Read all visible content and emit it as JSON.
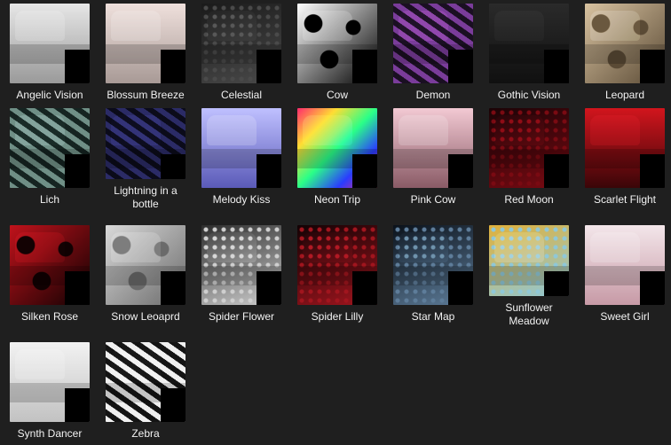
{
  "items": [
    {
      "label": "Angelic Vision",
      "c1": "#e6e6e6",
      "c2": "#9a9a9a",
      "pattern": "soft"
    },
    {
      "label": "Blossum Breeze",
      "c1": "#efe0dc",
      "c2": "#a89a96",
      "pattern": "soft"
    },
    {
      "label": "Celestial",
      "c1": "#4a4a4a",
      "c2": "#1a1a1a",
      "pattern": "dots"
    },
    {
      "label": "Cow",
      "c1": "#ffffff",
      "c2": "#000000",
      "pattern": "spots"
    },
    {
      "label": "Demon",
      "c1": "#7a3c9a",
      "c2": "#1a0f22",
      "pattern": "stripe"
    },
    {
      "label": "Gothic Vision",
      "c1": "#2a2a2a",
      "c2": "#101010",
      "pattern": "soft"
    },
    {
      "label": "Leopard",
      "c1": "#d8c2a0",
      "c2": "#5a4a35",
      "pattern": "spots"
    },
    {
      "label": "Lich",
      "c1": "#6f8f86",
      "c2": "#152421",
      "pattern": "stripe"
    },
    {
      "label": "Lightning in a bottle",
      "c1": "#2b2b66",
      "c2": "#0b0b1a",
      "pattern": "stripe"
    },
    {
      "label": "Melody Kiss",
      "c1": "#bfc0ff",
      "c2": "#5a5ab8",
      "pattern": "soft"
    },
    {
      "label": "Neon Trip",
      "c1": "#ffdd33",
      "c2": "#2a3cff",
      "pattern": "neon"
    },
    {
      "label": "Pink Cow",
      "c1": "#f2c9d3",
      "c2": "#8a5b66",
      "pattern": "soft"
    },
    {
      "label": "Red Moon",
      "c1": "#7a0a12",
      "c2": "#1a0306",
      "pattern": "dots"
    },
    {
      "label": "Scarlet Flight",
      "c1": "#d2151d",
      "c2": "#3a0508",
      "pattern": "soft"
    },
    {
      "label": "Silken Rose",
      "c1": "#c0121b",
      "c2": "#100102",
      "pattern": "spots"
    },
    {
      "label": "Snow Leoaprd",
      "c1": "#d9d9d9",
      "c2": "#6a6a6a",
      "pattern": "spots"
    },
    {
      "label": "Spider Flower",
      "c1": "#cfcfcf",
      "c2": "#2c2c2c",
      "pattern": "dots"
    },
    {
      "label": "Spider Lilly",
      "c1": "#a1151e",
      "c2": "#120204",
      "pattern": "dots"
    },
    {
      "label": "Star Map",
      "c1": "#5e7d9a",
      "c2": "#0a111a",
      "pattern": "dots"
    },
    {
      "label": "Sunflower Meadow",
      "c1": "#8fc8d8",
      "c2": "#e1b13a",
      "pattern": "dots"
    },
    {
      "label": "Sweet Girl",
      "c1": "#f3e6ea",
      "c2": "#c79aa6",
      "pattern": "soft"
    },
    {
      "label": "Synth Dancer",
      "c1": "#f2f2f2",
      "c2": "#c2c2c2",
      "pattern": "soft"
    },
    {
      "label": "Zebra",
      "c1": "#f0f0f0",
      "c2": "#141414",
      "pattern": "stripe"
    }
  ]
}
